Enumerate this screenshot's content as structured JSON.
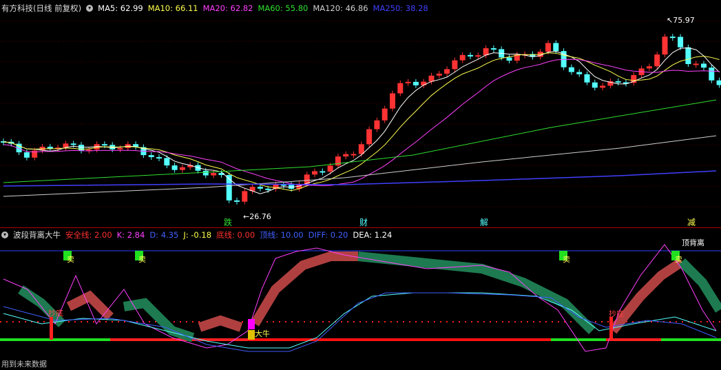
{
  "main_panel": {
    "title": "有方科技(日线 前复权)",
    "indicators": [
      {
        "label": "MA5: 62.99",
        "color": "#ffffff"
      },
      {
        "label": "MA10: 66.11",
        "color": "#ffff50"
      },
      {
        "label": "MA20: 62.82",
        "color": "#ff40ff"
      },
      {
        "label": "MA60: 55.80",
        "color": "#30e030"
      },
      {
        "label": "MA120: 46.86",
        "color": "#d0d0d0"
      },
      {
        "label": "MA250: 38.28",
        "color": "#4040ff"
      }
    ],
    "high_label": "75.97",
    "low_label": "26.76",
    "event_markers": [
      "跌",
      "财",
      "解",
      "减"
    ]
  },
  "sub_panel": {
    "title": "波段背离大牛",
    "indicators": [
      {
        "label": "安全线: 2.00",
        "color": "#ff3030"
      },
      {
        "label": "K: 2.84",
        "color": "#ff40ff"
      },
      {
        "label": "D: 4.35",
        "color": "#4060ff"
      },
      {
        "label": "J: -0.18",
        "color": "#ffff50"
      },
      {
        "label": "底线: 0.00",
        "color": "#ff3030"
      },
      {
        "label": "顶线: 10.00",
        "color": "#4060ff"
      },
      {
        "label": "DIFF: 0.20",
        "color": "#4060ff"
      },
      {
        "label": "DEA: 1.24",
        "color": "#ffffff"
      }
    ],
    "signal_labels": [
      "卖",
      "卖",
      "卖",
      "卖",
      "抄底",
      "抄底",
      "大牛",
      "顶背离"
    ]
  },
  "footer_text": "用到未来数据",
  "colors": {
    "up": "#ff3333",
    "down": "#54ffff",
    "grid": "#b00000"
  }
}
